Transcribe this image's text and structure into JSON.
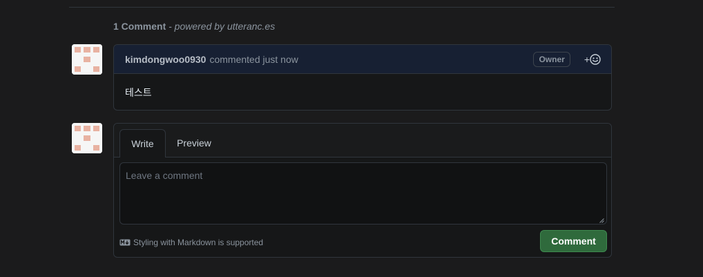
{
  "header": {
    "count_label": "1 Comment",
    "powered_label": "- powered by utteranc.es"
  },
  "comment": {
    "author": "kimdongwoo0930",
    "meta": "commented just now",
    "badge": "Owner",
    "reaction_plus": "+",
    "body": "테스트"
  },
  "form": {
    "tab_write": "Write",
    "tab_preview": "Preview",
    "placeholder": "Leave a comment",
    "markdown_note": "Styling with Markdown is supported",
    "submit_label": "Comment"
  },
  "icons": {
    "reaction": "smiley-icon",
    "markdown": "markdown-icon",
    "avatar": "identicon-avatar"
  },
  "colors": {
    "background": "#1b1b1c",
    "comment_header": "#172033",
    "submit_button": "#2f6a3c",
    "identicon": "#e8b2a2"
  }
}
